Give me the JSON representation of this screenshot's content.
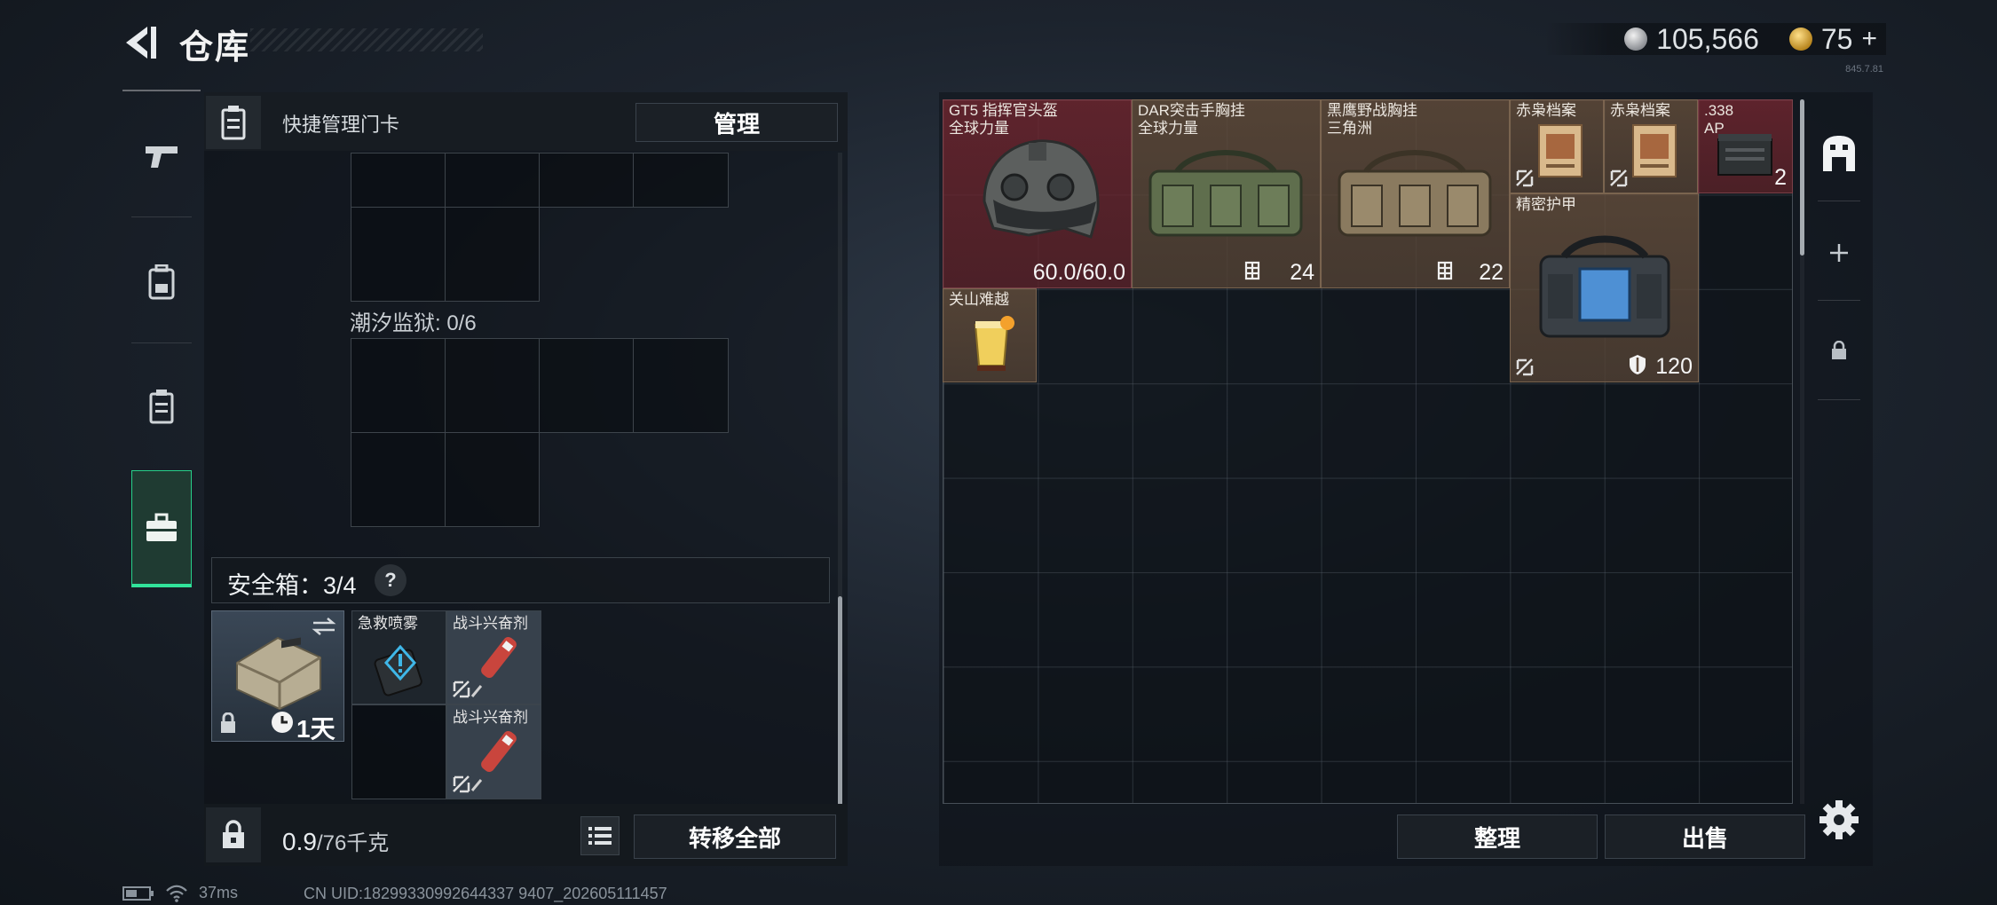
{
  "header": {
    "title": "仓库",
    "currency_silver": "105,566",
    "currency_gold": "75",
    "currency_plus": "+",
    "version": "845.7.81"
  },
  "left_tabs": [
    {
      "name": "weapons",
      "icon": "pistol-icon"
    },
    {
      "name": "gear",
      "icon": "backpack-icon"
    },
    {
      "name": "keycards",
      "icon": "keycard-icon"
    },
    {
      "name": "safebox",
      "icon": "briefcase-icon",
      "active": true
    }
  ],
  "keycard": {
    "label": "快捷管理门卡",
    "manage_label": "管理"
  },
  "prison": {
    "label": "潮汐监狱: 0/6"
  },
  "safe": {
    "title": "安全箱：3/4",
    "help": "?",
    "time_left": "1天",
    "items": [
      {
        "name": "急救喷雾"
      },
      {
        "name": "战斗兴奋剂"
      },
      {
        "name": "战斗兴奋剂"
      }
    ]
  },
  "bottom_left": {
    "weight_value": "0.9",
    "weight_cap": "/76千克",
    "transfer_label": "转移全部"
  },
  "stash": {
    "items": [
      {
        "name_line1": "GT5 指挥官头盔",
        "name_line2": "全球力量",
        "value": "60.0/60.0",
        "bg": "red"
      },
      {
        "name_line1": "DAR突击手胸挂",
        "name_line2": "全球力量",
        "value": "24",
        "bg": "brown"
      },
      {
        "name_line1": "黑鹰野战胸挂",
        "name_line2": "三角洲",
        "value": "22",
        "bg": "brown"
      },
      {
        "name_line1": "赤枭档案",
        "name_line2": "",
        "value": "",
        "bg": "brown"
      },
      {
        "name_line1": "赤枭档案",
        "name_line2": "",
        "value": "",
        "bg": "brown"
      },
      {
        "name_line1": ".338",
        "name_line2": "AP",
        "value": "2",
        "bg": "red"
      },
      {
        "name_line1": "精密护甲",
        "name_line2": "",
        "value": "120",
        "bg": "brown"
      },
      {
        "name_line1": "关山难越",
        "name_line2": "",
        "value": "",
        "bg": "brown"
      }
    ],
    "sort_label": "整理",
    "sell_label": "出售"
  },
  "status": {
    "ping": "37ms",
    "uid": "CN UID:18299330992644337 9407_202605111457"
  },
  "colors": {
    "accent_green": "#31e39a",
    "rarity_red": "#7a2a33",
    "rarity_brown": "#5e4a3a"
  }
}
